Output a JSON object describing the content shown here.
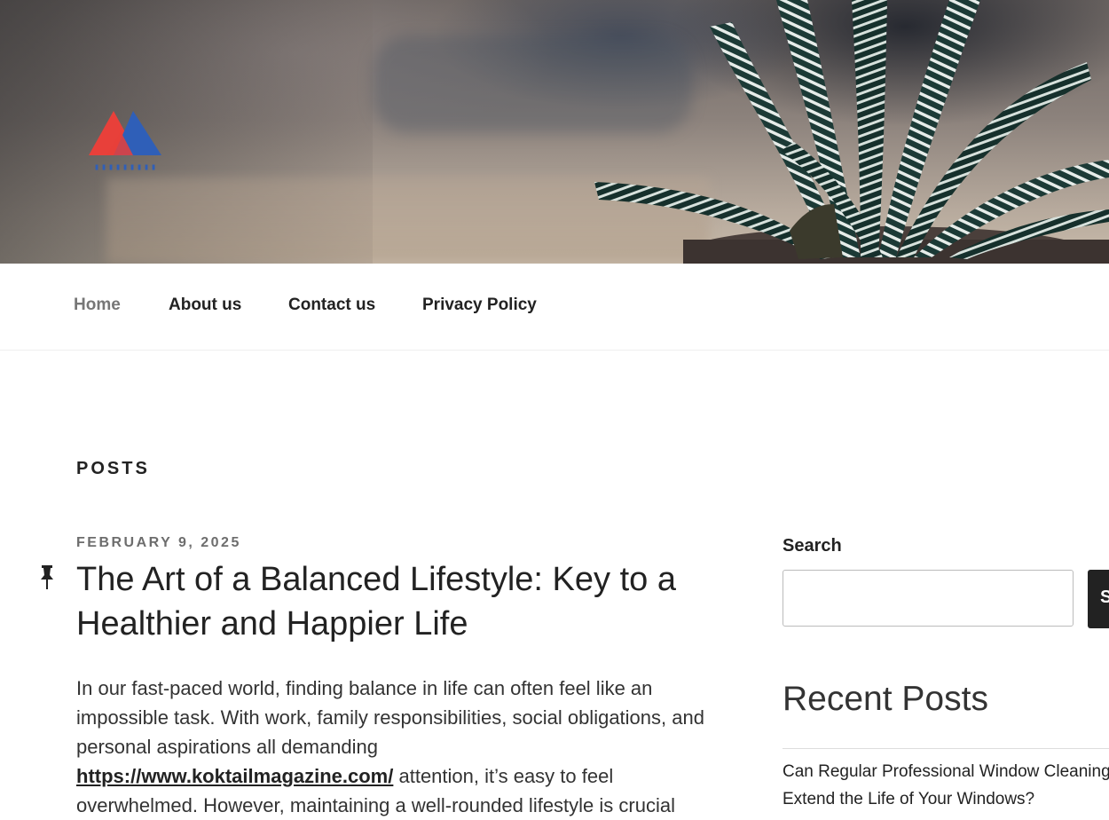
{
  "header": {
    "logo_icon": "mountain-logo-icon"
  },
  "nav": {
    "items": [
      {
        "label": "Home",
        "current": true
      },
      {
        "label": "About us"
      },
      {
        "label": "Contact us"
      },
      {
        "label": "Privacy Policy"
      }
    ]
  },
  "main": {
    "section_title": "POSTS",
    "post": {
      "date": "FEBRUARY 9, 2025",
      "sticky_icon": "pin-icon",
      "title": "The Art of a Balanced Lifestyle: Key to a Healthier and Happier Life",
      "body_before_link": "In our fast-paced world, finding balance in life can often feel like an impossible task. With work, family responsibilities, social obligations, and personal aspirations all demanding",
      "link_text": "https://www.koktailmagazine.com/",
      "body_after_link": " attention, it’s easy to feel overwhelmed. However, maintaining a well-rounded lifestyle is crucial"
    }
  },
  "sidebar": {
    "search_label": "Search",
    "search_placeholder": "",
    "search_button": "Search",
    "recent_title": "Recent Posts",
    "recent_posts": [
      "Can Regular Professional Window Cleaning Extend the Life of Your Windows?"
    ]
  },
  "colors": {
    "text": "#222222",
    "nav_current": "#767676",
    "date": "#6d6d6d",
    "button_bg": "#222222",
    "logo_red": "#e8403a",
    "logo_blue": "#2f5fb8"
  }
}
